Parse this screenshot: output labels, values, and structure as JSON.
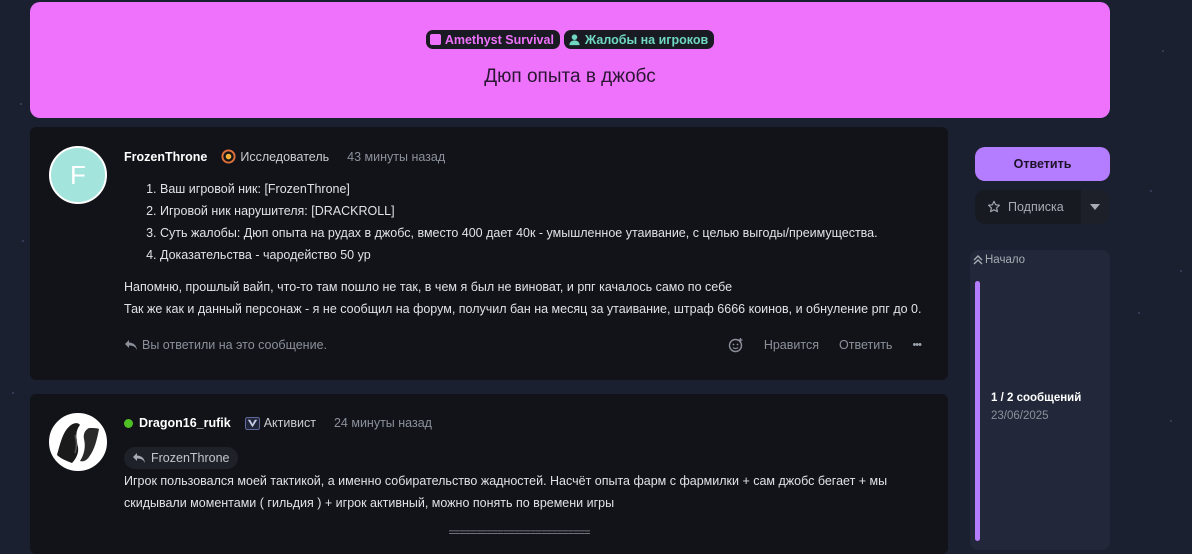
{
  "thread": {
    "tags": [
      {
        "label": "Amethyst Survival",
        "icon": "square-icon",
        "color": "#ee72fb"
      },
      {
        "label": "Жалобы на игроков",
        "icon": "user-icon",
        "color": "#6fd7c2"
      }
    ],
    "title": "Дюп опыта в джобс",
    "hero_color": "#ee72fb"
  },
  "posts": [
    {
      "author": "FrozenThrone",
      "avatar_letter": "F",
      "rank": "Исследователь",
      "time": "43 минуты назад",
      "list": [
        "Ваш игровой ник: [FrozenThrone]",
        "Игровой ник нарушителя: [DRACKROLL]",
        "Суть жалобы: Дюп опыта на рудах в джобс, вместо 400 дает 40к - умышленное утаивание, с целью выгоды/преимущества.",
        "Доказательства - чародейство 50 ур"
      ],
      "paragraphs": [
        "Напомню, прошлый вайп, что-то там пошло не так, в чем я был не виноват, и рпг качалось само по себе",
        "Так же как и данный персонаж - я не сообщил на форум, получил бан на месяц за утаивание, штраф 6666 коинов, и обнуление рпг до 0."
      ],
      "replied_note": "Вы ответили на это сообщение.",
      "like_label": "Нравится",
      "reply_label": "Ответить",
      "more_label": "•••"
    },
    {
      "author": "Dragon16_rufik",
      "rank": "Активист",
      "time": "24 минуты назад",
      "quote_author": "FrozenThrone",
      "text": "Игрок пользовался моей тактикой, а именно собирательство жадностей. Насчёт опыта фарм с фармилки + сам джобс бегает + мы скидывали моментами ( гильдия ) + игрок активный, можно понять по времени игры",
      "separator": "=========================="
    }
  ],
  "sidebar": {
    "reply_button": "Ответить",
    "subscribe_button": "Подписка",
    "start_label": "Начало",
    "progress_label": "1 / 2 сообщений",
    "progress_date": "23/06/2025",
    "accent_color": "#b47cff"
  }
}
